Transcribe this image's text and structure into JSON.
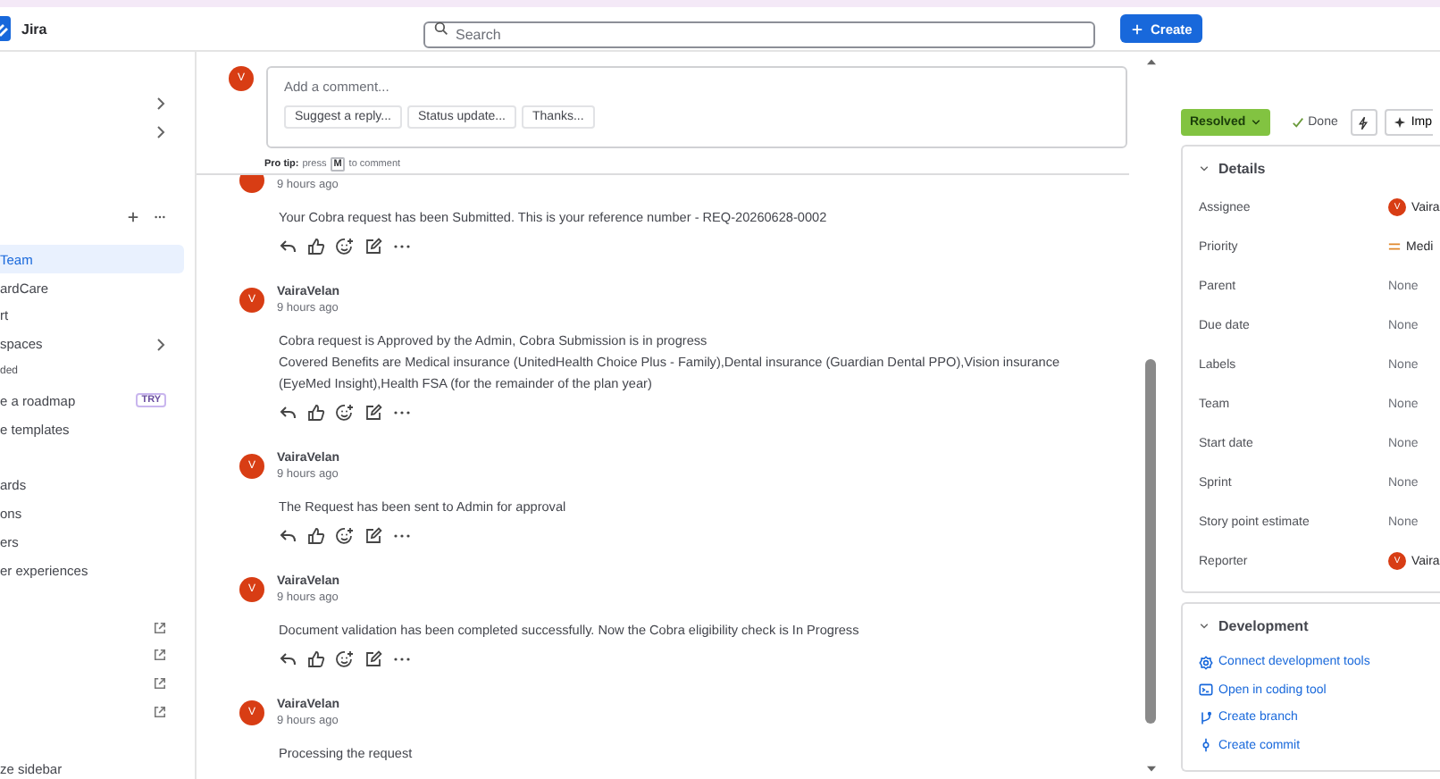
{
  "topbar": {
    "app_name": "Jira",
    "search": {
      "placeholder": "Search"
    },
    "create_button": "Create"
  },
  "sidebar": {
    "groups": [
      {
        "items": [
          {
            "kind": "expander",
            "selected": false
          },
          {
            "kind": "expander",
            "selected": false
          }
        ]
      },
      {
        "items": [
          {
            "kind": "section_actions"
          },
          {
            "kind": "item",
            "label": "Team",
            "selected": true
          },
          {
            "kind": "item",
            "label": "ardCare",
            "selected": false
          },
          {
            "kind": "item",
            "label": "rt",
            "selected": false
          },
          {
            "kind": "expander",
            "label": "spaces",
            "selected": false
          },
          {
            "kind": "caption",
            "label": "ded",
            "selected": false
          },
          {
            "kind": "badge",
            "label": "e a roadmap",
            "badge": "TRY",
            "selected": false
          },
          {
            "kind": "item",
            "label": "e templates",
            "selected": false
          }
        ]
      },
      {
        "items": [
          {
            "kind": "item",
            "label": "ards",
            "selected": false
          },
          {
            "kind": "item",
            "label": "ons",
            "selected": false
          },
          {
            "kind": "item",
            "label": "ers",
            "selected": false
          },
          {
            "kind": "item",
            "label": "er experiences",
            "selected": false
          }
        ]
      },
      {
        "items": [
          {
            "kind": "external",
            "selected": false
          },
          {
            "kind": "external",
            "selected": false
          },
          {
            "kind": "external",
            "selected": false
          },
          {
            "kind": "external",
            "selected": false
          }
        ]
      },
      {
        "items": [
          {
            "kind": "item",
            "label": "ze sidebar",
            "selected": false
          }
        ]
      }
    ]
  },
  "composer": {
    "avatar": "V",
    "placeholder": "Add a comment...",
    "suggestions": [
      "Suggest a reply...",
      "Status update...",
      "Thanks..."
    ],
    "pro_tip": {
      "lead": "Pro tip:",
      "before": "press",
      "key": "M",
      "after": "to comment"
    }
  },
  "comments": [
    {
      "time": "9 hours ago",
      "body": [
        "Your Cobra request has been Submitted. This is your reference number - REQ-20260628-0002"
      ]
    },
    {
      "avatar": "V",
      "author": "VairaVelan",
      "time": "9 hours ago",
      "body": [
        "Cobra request is Approved by the Admin, Cobra Submission is in progress",
        "Covered Benefits are Medical insurance (UnitedHealth Choice Plus - Family),Dental insurance (Guardian Dental PPO),Vision insurance (EyeMed Insight),Health FSA (for the remainder of the plan year)"
      ]
    },
    {
      "avatar": "V",
      "author": "VairaVelan",
      "time": "9 hours ago",
      "body": [
        "The Request has been sent to Admin for approval"
      ]
    },
    {
      "avatar": "V",
      "author": "VairaVelan",
      "time": "9 hours ago",
      "body": [
        "Document validation has been completed successfully. Now the Cobra eligibility check is In Progress"
      ]
    },
    {
      "avatar": "V",
      "author": "VairaVelan",
      "time": "9 hours ago",
      "body": [
        "Processing the request"
      ]
    }
  ],
  "status_bar": {
    "status": "Resolved",
    "resolution": "Done",
    "improve": "Imp"
  },
  "details": {
    "title": "Details",
    "expanded": true,
    "fields": [
      {
        "label": "Assignee",
        "kind": "user",
        "avatar": "V",
        "value": "Vaira"
      },
      {
        "label": "Priority",
        "kind": "priority",
        "value": "Medi"
      },
      {
        "label": "Parent",
        "kind": "empty",
        "value": "None"
      },
      {
        "label": "Due date",
        "kind": "empty",
        "value": "None"
      },
      {
        "label": "Labels",
        "kind": "empty",
        "value": "None"
      },
      {
        "label": "Team",
        "kind": "empty",
        "value": "None"
      },
      {
        "label": "Start date",
        "kind": "empty",
        "value": "None"
      },
      {
        "label": "Sprint",
        "kind": "empty",
        "value": "None"
      },
      {
        "label": "Story point estimate",
        "kind": "empty",
        "value": "None"
      },
      {
        "label": "Reporter",
        "kind": "user",
        "avatar": "V",
        "value": "Vaira"
      }
    ]
  },
  "development": {
    "title": "Development",
    "expanded": true,
    "links": [
      {
        "kind": "gear",
        "label": "Connect development tools"
      },
      {
        "kind": "terminal",
        "label": "Open in coding tool"
      },
      {
        "kind": "branch",
        "label": "Create branch"
      },
      {
        "kind": "commit",
        "label": "Create commit"
      }
    ]
  }
}
